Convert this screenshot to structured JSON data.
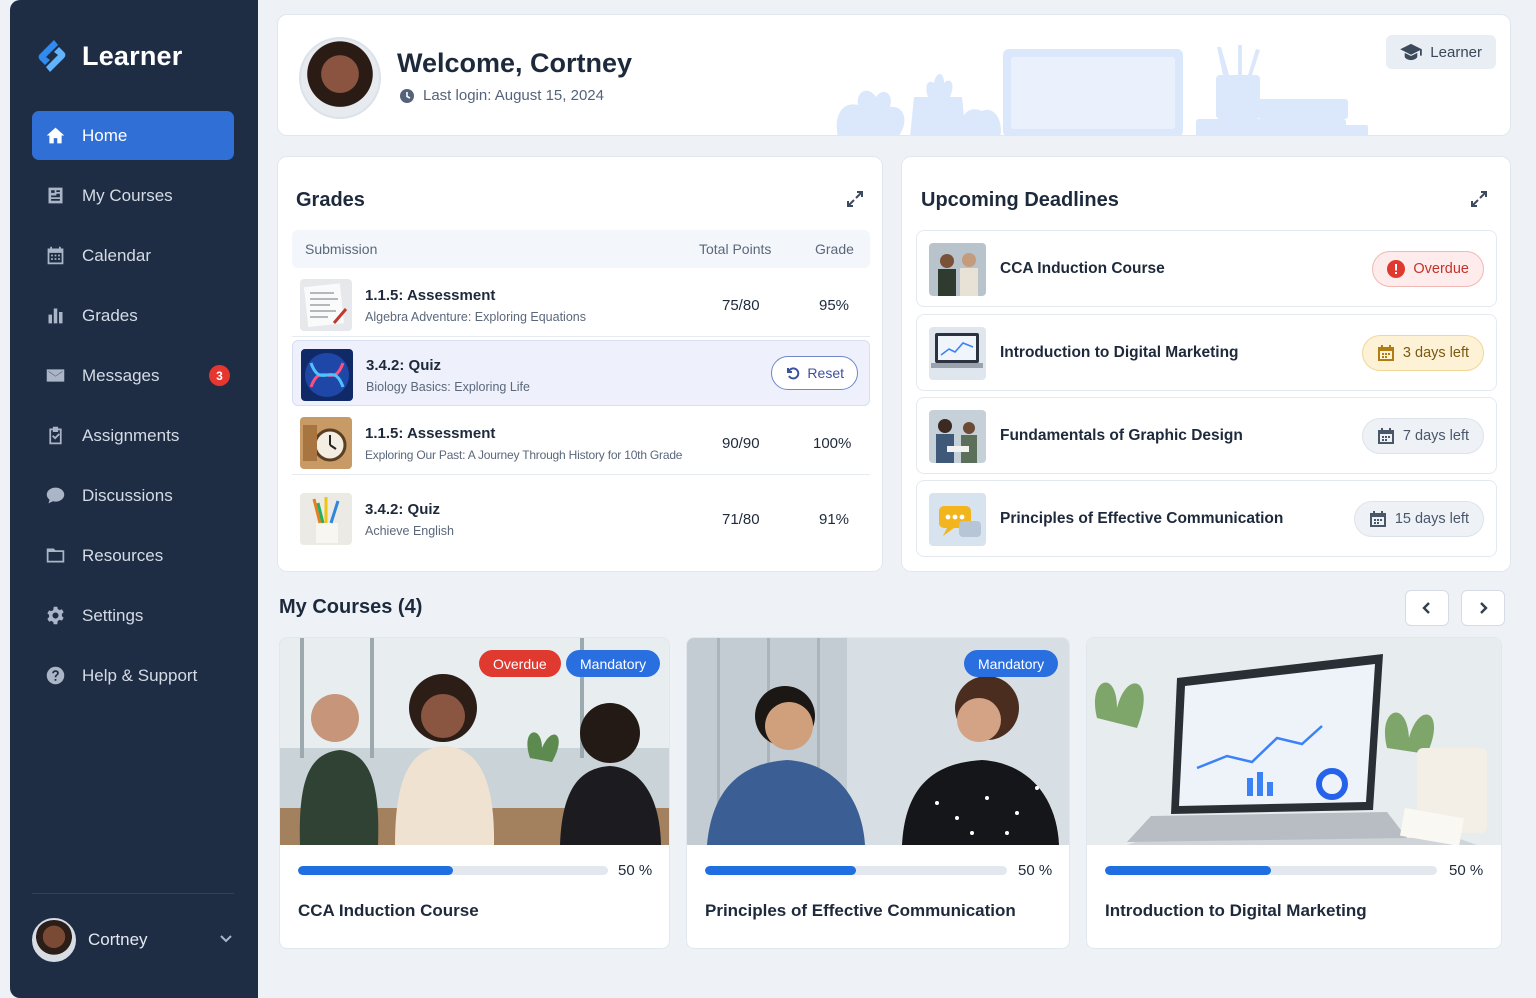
{
  "app": {
    "name": "Learner"
  },
  "sidebar": {
    "items": [
      {
        "label": "Home",
        "icon": "home-icon",
        "active": true
      },
      {
        "label": "My Courses",
        "icon": "book-icon"
      },
      {
        "label": "Calendar",
        "icon": "calendar-icon"
      },
      {
        "label": "Grades",
        "icon": "bar-chart-icon"
      },
      {
        "label": "Messages",
        "icon": "envelope-icon",
        "badge": "3"
      },
      {
        "label": "Assignments",
        "icon": "clipboard-icon"
      },
      {
        "label": "Discussions",
        "icon": "chat-bubble-icon"
      },
      {
        "label": "Resources",
        "icon": "folder-icon"
      },
      {
        "label": "Settings",
        "icon": "gear-icon"
      },
      {
        "label": "Help & Support",
        "icon": "help-circle-icon"
      }
    ],
    "user": {
      "name": "Cortney"
    }
  },
  "header": {
    "welcome": "Welcome, Cortney",
    "last_login": "Last login: August 15, 2024",
    "role": "Learner"
  },
  "grades": {
    "title": "Grades",
    "columns": {
      "submission": "Submission",
      "points": "Total Points",
      "grade": "Grade"
    },
    "rows": [
      {
        "title": "1.1.5: Assessment",
        "course": "Algebra Adventure: Exploring Equations",
        "points": "75/80",
        "grade": "95%"
      },
      {
        "title": "3.4.2: Quiz",
        "course": "Biology Basics: Exploring Life",
        "action": "Reset"
      },
      {
        "title": "1.1.5: Assessment",
        "course": "Exploring Our Past: A Journey Through History for 10th Grade",
        "points": "90/90",
        "grade": "100%"
      },
      {
        "title": "3.4.2: Quiz",
        "course": "Achieve English",
        "points": "71/80",
        "grade": "91%"
      }
    ]
  },
  "deadlines": {
    "title": "Upcoming Deadlines",
    "items": [
      {
        "title": "CCA Induction Course",
        "status": "Overdue"
      },
      {
        "title": "Introduction to Digital Marketing",
        "status": "3 days left"
      },
      {
        "title": "Fundamentals of Graphic Design",
        "status": "7 days left"
      },
      {
        "title": "Principles of Effective Communication",
        "status": "15 days left"
      }
    ]
  },
  "my_courses": {
    "title": "My Courses (4)",
    "cards": [
      {
        "name": "CCA Induction Course",
        "progress_label": "50 %",
        "progress": 0.5,
        "tags": [
          "Overdue",
          "Mandatory"
        ]
      },
      {
        "name": "Principles of Effective Communication",
        "progress_label": "50 %",
        "progress": 0.5,
        "tags": [
          "Mandatory"
        ]
      },
      {
        "name": "Introduction to Digital Marketing",
        "progress_label": "50 %",
        "progress": 0.5,
        "tags": []
      }
    ]
  },
  "colors": {
    "sidebar": "#1f2d44",
    "accent": "#2f6fd6",
    "overdue": "#e0392f",
    "mandatory": "#2a6fe0"
  }
}
